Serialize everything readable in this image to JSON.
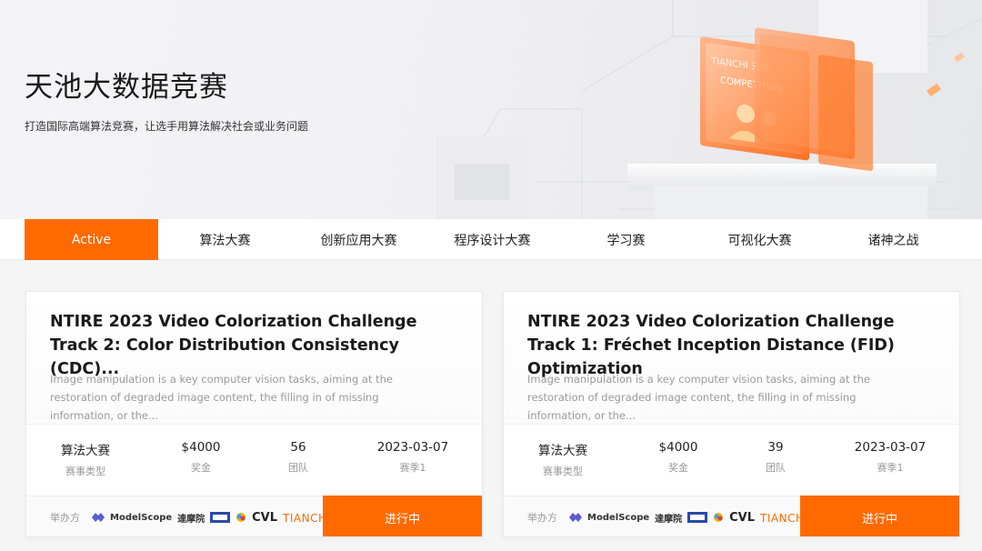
{
  "hero": {
    "title": "天池大数据竞赛",
    "subtitle": "打造国际高端算法竞赛，让选手用算法解决社会或业务问题",
    "art_labels": [
      "COMPETITION",
      "TIANCHI 天池"
    ]
  },
  "tabs": [
    {
      "label": "Active",
      "active": true
    },
    {
      "label": "算法大赛",
      "active": false
    },
    {
      "label": "创新应用大赛",
      "active": false
    },
    {
      "label": "程序设计大赛",
      "active": false
    },
    {
      "label": "学习赛",
      "active": false
    },
    {
      "label": "可视化大赛",
      "active": false
    },
    {
      "label": "诸神之战",
      "active": false
    }
  ],
  "cards": [
    {
      "title": "NTIRE 2023 Video Colorization Challenge Track 2: Color Distribution Consistency (CDC)...",
      "description": "Image manipulation is a key computer vision tasks, aiming at the restoration of degraded image content, the filling in of missing information, or the...",
      "stats": [
        {
          "value": "算法大赛",
          "label": "赛事类型"
        },
        {
          "value": "$4000",
          "label": "奖金"
        },
        {
          "value": "56",
          "label": "团队"
        },
        {
          "value": "2023-03-07",
          "label": "赛季1"
        }
      ],
      "organizer_label": "举办方",
      "organizers": [
        "ModelScope",
        "達摩院",
        "CVL",
        "TIANCHI 天池"
      ],
      "status": "进行中"
    },
    {
      "title": "NTIRE 2023 Video Colorization Challenge Track 1: Fréchet Inception Distance (FID) Optimization",
      "description": "Image manipulation is a key computer vision tasks, aiming at the restoration of degraded image content, the filling in of missing information, or the...",
      "stats": [
        {
          "value": "算法大赛",
          "label": "赛事类型"
        },
        {
          "value": "$4000",
          "label": "奖金"
        },
        {
          "value": "39",
          "label": "团队"
        },
        {
          "value": "2023-03-07",
          "label": "赛季1"
        }
      ],
      "organizer_label": "举办方",
      "organizers": [
        "ModelScope",
        "達摩院",
        "CVL",
        "TIANCHI 天池"
      ],
      "status": "进行中"
    }
  ],
  "colors": {
    "accent": "#ff6a00",
    "muted": "#999999"
  }
}
